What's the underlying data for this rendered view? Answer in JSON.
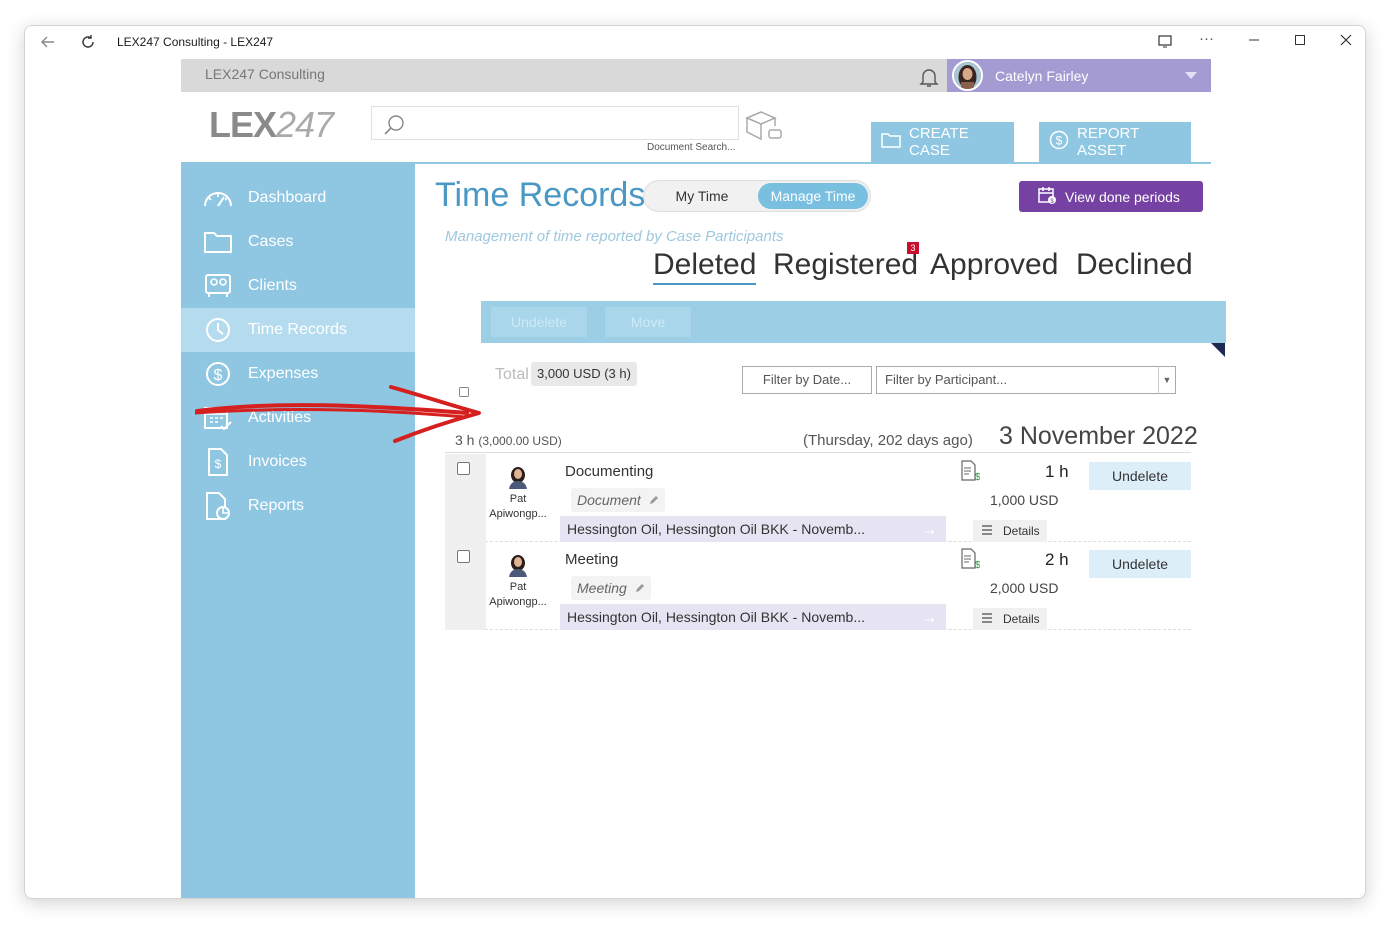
{
  "window": {
    "title": "LEX247 Consulting - LEX247"
  },
  "topbar": {
    "firm": "LEX247 Consulting",
    "user": "Catelyn Fairley"
  },
  "header": {
    "logo_main": "LEX",
    "logo_num": "247",
    "search_caption": "Document Search...",
    "create_case": "CREATE CASE",
    "report_asset": "REPORT ASSET"
  },
  "sidebar": {
    "items": [
      {
        "label": "Dashboard",
        "icon": "dashboard-icon"
      },
      {
        "label": "Cases",
        "icon": "folder-icon"
      },
      {
        "label": "Clients",
        "icon": "clients-icon"
      },
      {
        "label": "Time Records",
        "icon": "clock-icon"
      },
      {
        "label": "Expenses",
        "icon": "dollar-circle-icon"
      },
      {
        "label": "Activities",
        "icon": "calendar-check-icon"
      },
      {
        "label": "Invoices",
        "icon": "invoice-icon"
      },
      {
        "label": "Reports",
        "icon": "report-icon"
      }
    ],
    "active": "Time Records"
  },
  "main": {
    "title": "Time Records",
    "toggle": {
      "mine": "My Time",
      "manage": "Manage Time",
      "selected": "Manage Time"
    },
    "view_done": "View done periods",
    "subtitle": "Management of time reported by Case Participants",
    "tabs": {
      "deleted": "Deleted",
      "registered": "Registered",
      "registered_badge": "3",
      "approved": "Approved",
      "declined": "Declined",
      "active": "Deleted"
    },
    "actions": {
      "undelete": "Undelete",
      "move": "Move"
    },
    "total_label": "Total",
    "total_value": "3,000 USD (3 h)",
    "filter_date": "Filter by Date...",
    "filter_participant": "Filter by Participant...",
    "day": {
      "hours": "3 h",
      "amount": "(3,000.00 USD)",
      "info": "(Thursday, 202 days ago)",
      "date": "3 November 2022"
    },
    "entries": [
      {
        "person_first": "Pat",
        "person_last": "Apiwongp...",
        "title": "Documenting",
        "tag": "Document",
        "case": "Hessington Oil, Hessington Oil BKK - Novemb...",
        "hours": "1 h",
        "amount": "1,000 USD",
        "details": "Details",
        "action": "Undelete"
      },
      {
        "person_first": "Pat",
        "person_last": "Apiwongp...",
        "title": "Meeting",
        "tag": "Meeting",
        "case": "Hessington Oil, Hessington Oil BKK - Novemb...",
        "hours": "2 h",
        "amount": "2,000 USD",
        "details": "Details",
        "action": "Undelete"
      }
    ]
  },
  "colors": {
    "sidebar": "#8fc7e3",
    "accent": "#4a98c4",
    "purple": "#7542a3",
    "user_bar": "#a39bd1"
  }
}
